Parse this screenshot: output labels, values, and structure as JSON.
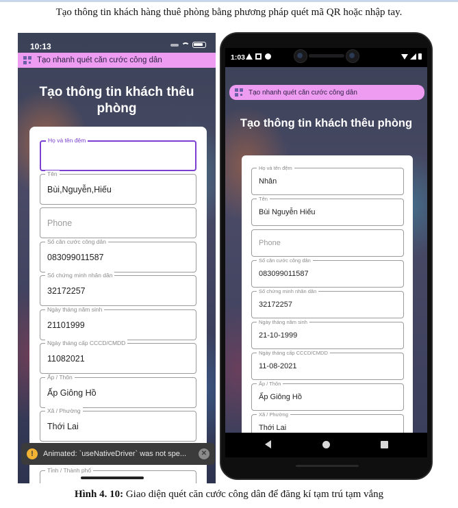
{
  "document": {
    "heading": "Tạo thông tin khách hàng thuê phòng bằng phương pháp quét mã QR hoặc nhập tay.",
    "caption_label": "Hình 4. 10:",
    "caption_text": " Giao diện quét căn cước công dân để đăng kí tạm trú tạm vắng"
  },
  "ios_screen": {
    "status_time": "10:13",
    "scan_pill_text": "Tạo nhanh quét căn cước công dân",
    "title": "Tạo thông tin khách thêu phòng",
    "fields": [
      {
        "label": "Họ và tên đệm",
        "value": ""
      },
      {
        "label": "Tên",
        "value": "Bùi,Nguyễn,Hiếu"
      },
      {
        "label": "",
        "placeholder": "Phone"
      },
      {
        "label": "Số căn cước công dân",
        "value": "083099011587"
      },
      {
        "label": "Số chứng minh nhân dân",
        "value": "32172257"
      },
      {
        "label": "Ngày tháng năm sinh",
        "value": "21101999"
      },
      {
        "label": "Ngày tháng cấp CCCD/CMDD",
        "value": "11082021"
      },
      {
        "label": "Ấp / Thôn",
        "value": "Ấp Giông Hồ"
      },
      {
        "label": "Xã / Phường",
        "value": "Thới Lai"
      }
    ],
    "tail_field_label": "Tỉnh / Thành phố",
    "toast_text": "Animated: `useNativeDriver` was not spe...",
    "toast_warn_glyph": "!",
    "toast_close_glyph": "✕"
  },
  "android_screen": {
    "status_time": "1:03",
    "scan_pill_text": "Tạo nhanh quét căn cước công dân",
    "title": "Tạo thông tin khách thêu phòng",
    "fields": [
      {
        "label": "Họ và tên đệm",
        "value": "Nhân"
      },
      {
        "label": "Tên",
        "value": "Bùi Nguyễn Hiếu"
      },
      {
        "label": "",
        "placeholder": "Phone"
      },
      {
        "label": "Số căn cước công dân",
        "value": "083099011587"
      },
      {
        "label": "Số chứng minh nhân dân",
        "value": "32172257"
      },
      {
        "label": "Ngày tháng năm sinh",
        "value": "21-10-1999"
      },
      {
        "label": "Ngày tháng cấp CCCD/CMDD",
        "value": "11-08-2021"
      },
      {
        "label": "Ấp / Thôn",
        "value": "Ấp Giông Hồ"
      },
      {
        "label": "Xã / Phường",
        "value": "Thới Lai"
      }
    ]
  },
  "colors": {
    "pill_bg": "#ee9cf2",
    "focus_border": "#7a3fd0",
    "toast_bg": "#3b3b3b",
    "warn": "#f2b233"
  },
  "icons": [
    "qr-scan-icon",
    "warning-icon",
    "close-icon",
    "wifi-icon",
    "battery-icon",
    "signal-icon",
    "back-nav-icon",
    "home-nav-icon",
    "recents-nav-icon"
  ]
}
